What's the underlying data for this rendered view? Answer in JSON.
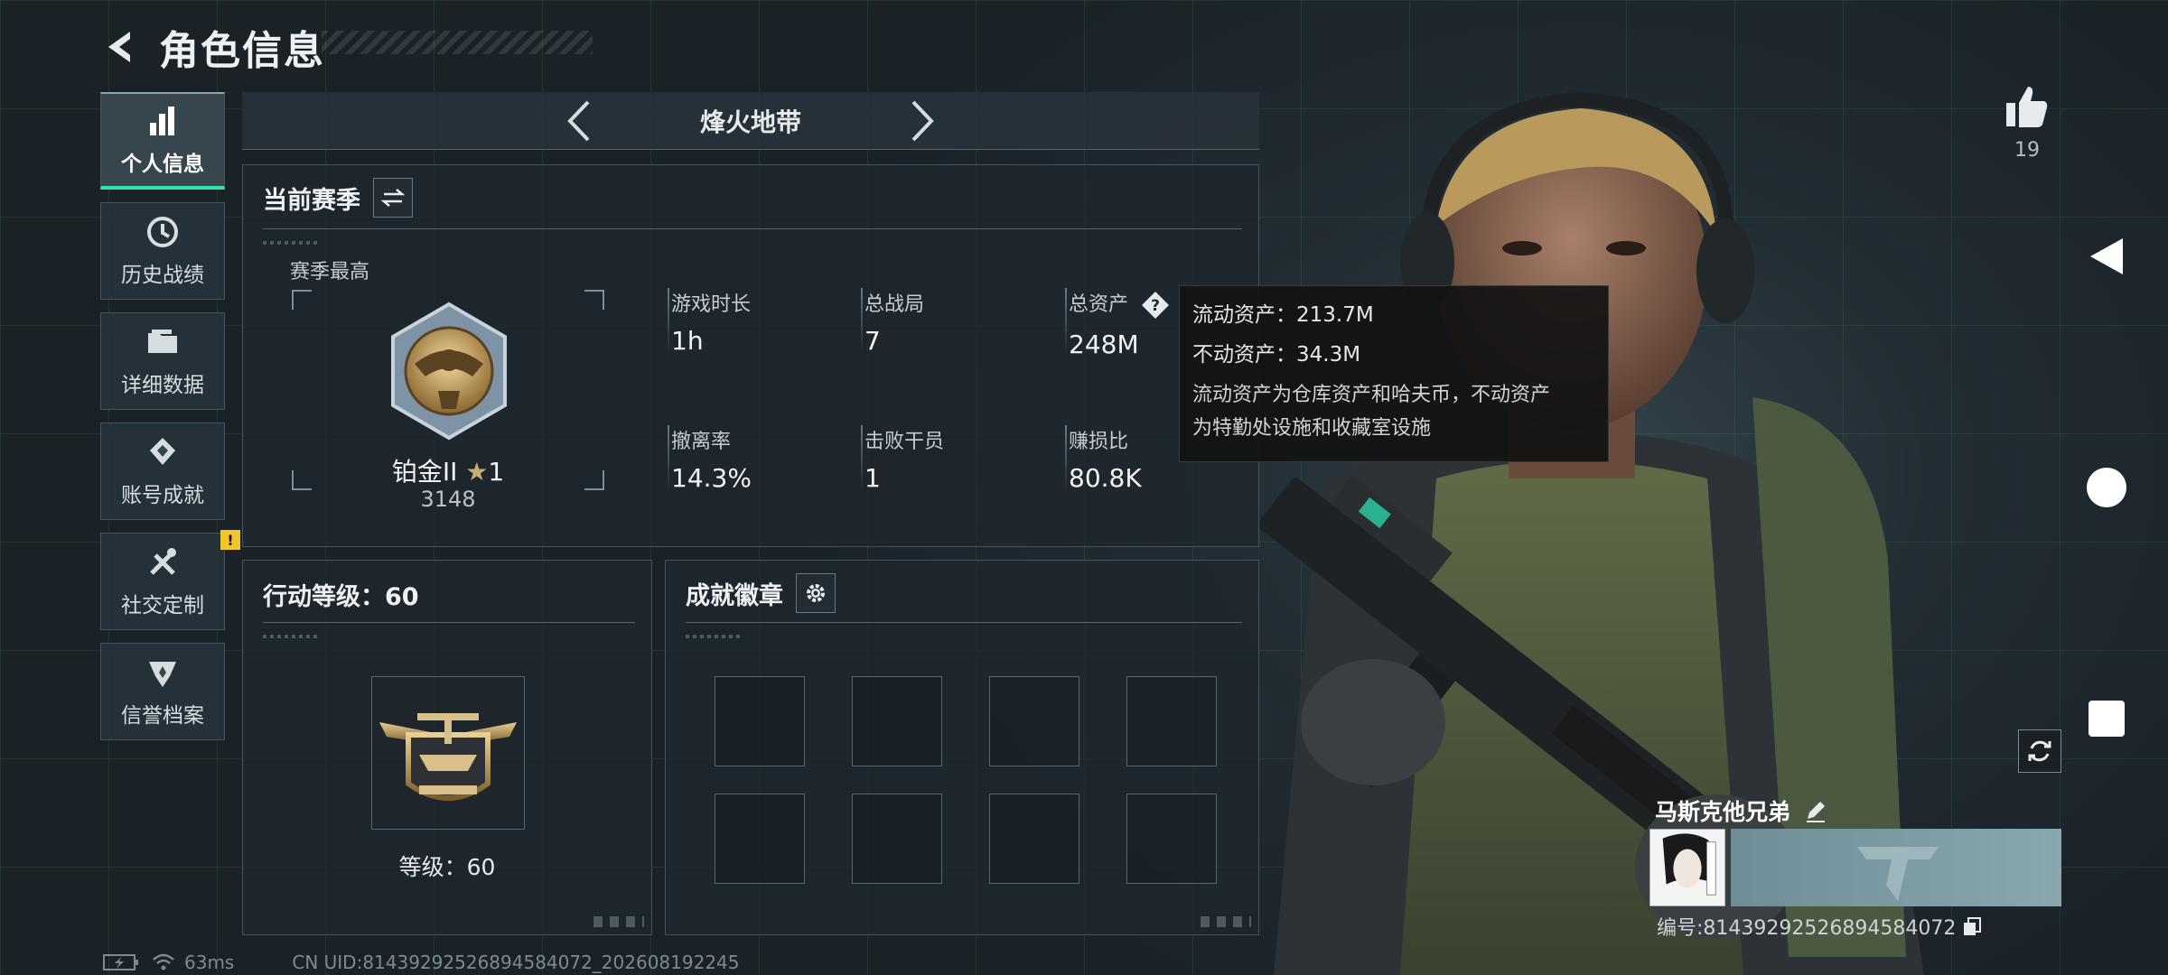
{
  "header": {
    "title": "角色信息"
  },
  "nav": {
    "items": [
      {
        "label": "个人信息",
        "icon": "bar-chart-icon",
        "active": true
      },
      {
        "label": "历史战绩",
        "icon": "history-icon"
      },
      {
        "label": "详细数据",
        "icon": "folder-icon"
      },
      {
        "label": "账号成就",
        "icon": "achievement-icon"
      },
      {
        "label": "社交定制",
        "icon": "tools-icon",
        "badge": "!"
      },
      {
        "label": "信誉档案",
        "icon": "shield-icon"
      }
    ]
  },
  "mode": {
    "title": "烽火地带"
  },
  "season": {
    "title": "当前赛季",
    "best_label": "赛季最高",
    "rank_name": "铂金II",
    "rank_star": "★",
    "rank_star_count": "1",
    "rank_score": "3148",
    "stats": [
      {
        "label": "游戏时长",
        "value": "1h"
      },
      {
        "label": "总战局",
        "value": "7"
      },
      {
        "label": "总资产",
        "value": "248M"
      },
      {
        "label": "撤离率",
        "value": "14.3%"
      },
      {
        "label": "击败干员",
        "value": "1"
      },
      {
        "label": "赚损比",
        "value": "80.8K"
      }
    ]
  },
  "tooltip": {
    "liquid": "流动资产：213.7M",
    "fixed": "不动资产：34.3M",
    "note_line1": "流动资产为仓库资产和哈夫币，不动资产",
    "note_line2": "为特勤处设施和收藏室设施"
  },
  "level": {
    "title": "行动等级：60",
    "level_text": "等级：60"
  },
  "achievements": {
    "title": "成就徽章",
    "slots": 8
  },
  "social": {
    "likes": "19"
  },
  "player": {
    "name": "马斯克他兄弟",
    "id_text": "编号:8143929252689458407​2"
  },
  "status": {
    "ping": "63ms",
    "uid": "CN UID:81439292526894584072_202608192245"
  },
  "colors": {
    "accent": "#2ee6a6",
    "badge": "#f2c52b"
  }
}
